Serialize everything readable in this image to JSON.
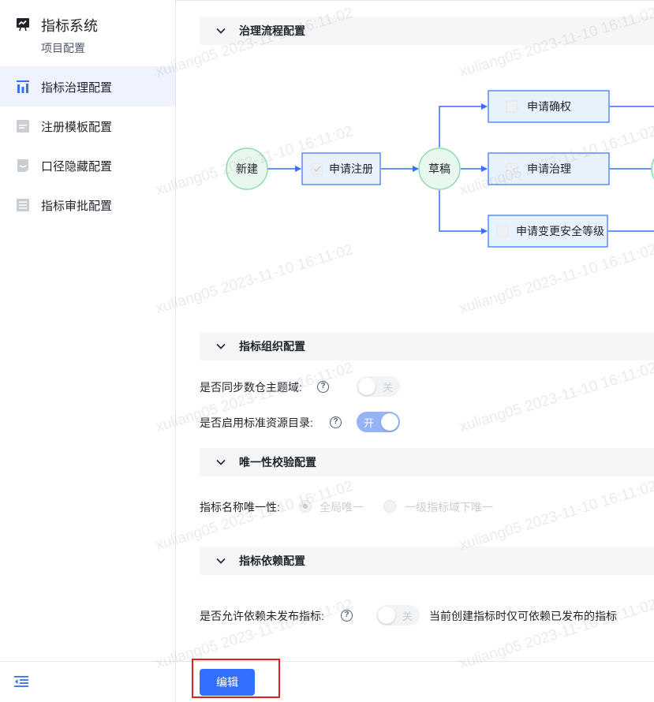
{
  "sidebar": {
    "app_title": "指标系统",
    "subtitle": "项目配置",
    "items": [
      {
        "label": "指标治理配置",
        "icon": "governance-chart-icon",
        "active": true
      },
      {
        "label": "注册模板配置",
        "icon": "template-icon",
        "active": false
      },
      {
        "label": "口径隐藏配置",
        "icon": "caliber-hide-icon",
        "active": false
      },
      {
        "label": "指标审批配置",
        "icon": "approval-list-icon",
        "active": false
      }
    ]
  },
  "sections": {
    "flow": {
      "title": "治理流程配置",
      "nodes": {
        "start": "新建",
        "register": "申请注册",
        "draft": "草稿",
        "confirm": "申请确权",
        "govern": "申请治理",
        "security": "申请变更安全等级"
      }
    },
    "org": {
      "title": "指标组织配置",
      "sync_label": "是否同步数仓主题域:",
      "sync_switch_text": "关",
      "catalog_label": "是否启用标准资源目录:",
      "catalog_switch_text": "开"
    },
    "uniq": {
      "title": "唯一性校验配置",
      "name_label": "指标名称唯一性:",
      "options": [
        "全局唯一",
        "一级指标域下唯一"
      ],
      "selected": "全局唯一"
    },
    "dep": {
      "title": "指标依赖配置",
      "allow_label": "是否允许依赖未发布指标:",
      "switch_text": "关",
      "hint": "当前创建指标时仅可依赖已发布的指标"
    }
  },
  "footer": {
    "edit_label": "编辑"
  },
  "watermark": "xuliang05 2023-11-10 16:11:02",
  "colors": {
    "primary": "#3370ff",
    "node_green": "#8fdcae",
    "node_fill": "#e8f2fd",
    "highlight": "#e02020"
  }
}
